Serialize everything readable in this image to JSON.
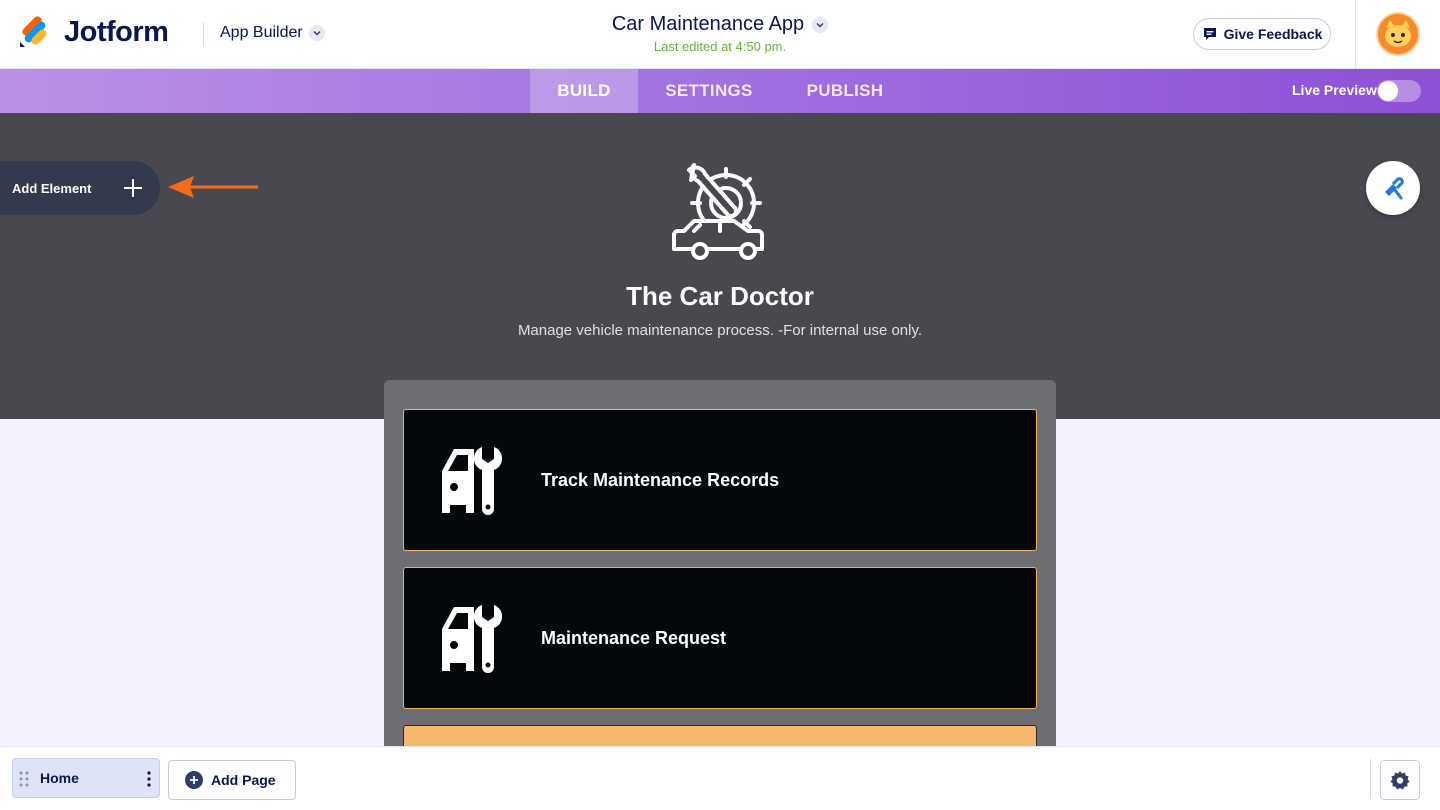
{
  "header": {
    "brand": "Jotform",
    "product": "App Builder",
    "app_title": "Car Maintenance App",
    "last_edited": "Last edited at 4:50 pm.",
    "feedback_label": "Give Feedback"
  },
  "nav": {
    "tabs": [
      {
        "label": "BUILD",
        "active": true
      },
      {
        "label": "SETTINGS",
        "active": false
      },
      {
        "label": "PUBLISH",
        "active": false
      }
    ],
    "live_preview_label": "Live Preview",
    "live_preview_on": false
  },
  "hero": {
    "icon": "car-gear-wrench-icon",
    "title": "The Car Doctor",
    "subtitle": "Manage vehicle maintenance process. -For internal use only."
  },
  "sidebar": {
    "add_element_label": "Add Element"
  },
  "cards": [
    {
      "label": "Track Maintenance Records",
      "icon": "car-wrench-icon"
    },
    {
      "label": "Maintenance Request",
      "icon": "car-wrench-icon"
    }
  ],
  "footer": {
    "pages": [
      {
        "label": "Home",
        "selected": true
      }
    ],
    "add_page_label": "Add Page"
  },
  "colors": {
    "accent_purple": "#a374e0",
    "hero_bg": "#48484e",
    "card_bg": "#05080b",
    "card_border": "#f0b25a",
    "arrow": "#f56b1c",
    "last_edited": "#64b239"
  }
}
